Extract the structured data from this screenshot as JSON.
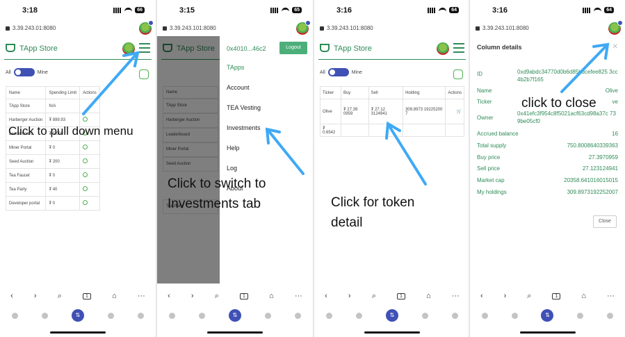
{
  "screens": [
    {
      "status_time": "3:18",
      "battery": "66",
      "url": "3.39.243.01:8080",
      "brand": "TApp Store",
      "toggle_all": "All",
      "toggle_mine": "Mine",
      "columns": [
        "Name",
        "Spending Limit",
        "Actions"
      ],
      "rows": [
        {
          "name": "TApp Store",
          "limit": "N/A"
        },
        {
          "name": "Harberger Auction",
          "limit": "₮ 899.93"
        },
        {
          "name": "Leaderboard",
          "limit": "₮ 5.003"
        },
        {
          "name": "Miner Portal",
          "limit": "₮ 0"
        },
        {
          "name": "Seed Auction",
          "limit": "₮ 200"
        },
        {
          "name": "Tea Faucet",
          "limit": "₮ 0"
        },
        {
          "name": "Tea Party",
          "limit": "₮ 40"
        },
        {
          "name": "Developer portal",
          "limit": "₮ 0"
        }
      ],
      "callout": "Click to pull down menu"
    },
    {
      "status_time": "3:15",
      "battery": "65",
      "url": "3.39.243.101:8080",
      "brand": "TApp Store",
      "account": "0x4010...46c2",
      "logout": "Logout",
      "menu": [
        "TApps",
        "Account",
        "TEA Vesting",
        "Investments",
        "Help",
        "Log",
        "About"
      ],
      "bg_rows": [
        "Name",
        "TApp Store",
        "Harberger Auction",
        "Leaderboard",
        "Miner Portal",
        "Seed Auction",
        "Tea Party"
      ],
      "callout_line1": "Click to switch to",
      "callout_line2": "Investments tab"
    },
    {
      "status_time": "3:16",
      "battery": "64",
      "url": "3.39.243.101:8080",
      "brand": "TApp Store",
      "toggle_all": "All",
      "toggle_mine": "Mine",
      "columns": [
        "Ticker",
        "Buy",
        "Sell",
        "Holding",
        "Actions"
      ],
      "row": {
        "ticker": "Olive",
        "buy": "₮ 27.39 0959",
        "sell": "₮ 27.12 3124941",
        "holding": "309.8973 19225200 7"
      },
      "total": "₮ 0.6542",
      "callout_line1": "Click for token",
      "callout_line2": "detail"
    },
    {
      "status_time": "3:16",
      "battery": "64",
      "url": "3.39.243.101:8080",
      "title": "Column details",
      "id": "0xd9abdc34770d0b6d85bdcefee825 3cc4b2b7f165",
      "fields": [
        {
          "k": "Name",
          "v": "Olive"
        },
        {
          "k": "Ticker",
          "v": "ve"
        },
        {
          "k": "Accrued balance",
          "v": "16"
        },
        {
          "k": "Total supply",
          "v": "750.8008640339363"
        },
        {
          "k": "Buy price",
          "v": "27.3970959"
        },
        {
          "k": "Sell price",
          "v": "27.123124941"
        },
        {
          "k": "Market cap",
          "v": "20358.641016015015"
        },
        {
          "k": "My holdings",
          "v": "309.8973192252007"
        }
      ],
      "id_label": "ID",
      "owner_label": "Owner",
      "owner": "0x41efc3f954c8f5021acf63cd98a37c 739be05cf0",
      "close": "Close",
      "callout": "click to close"
    }
  ],
  "colors": {
    "accent": "#2e8b57",
    "primary": "#3f51b5",
    "arrow": "#3fa9f5"
  }
}
